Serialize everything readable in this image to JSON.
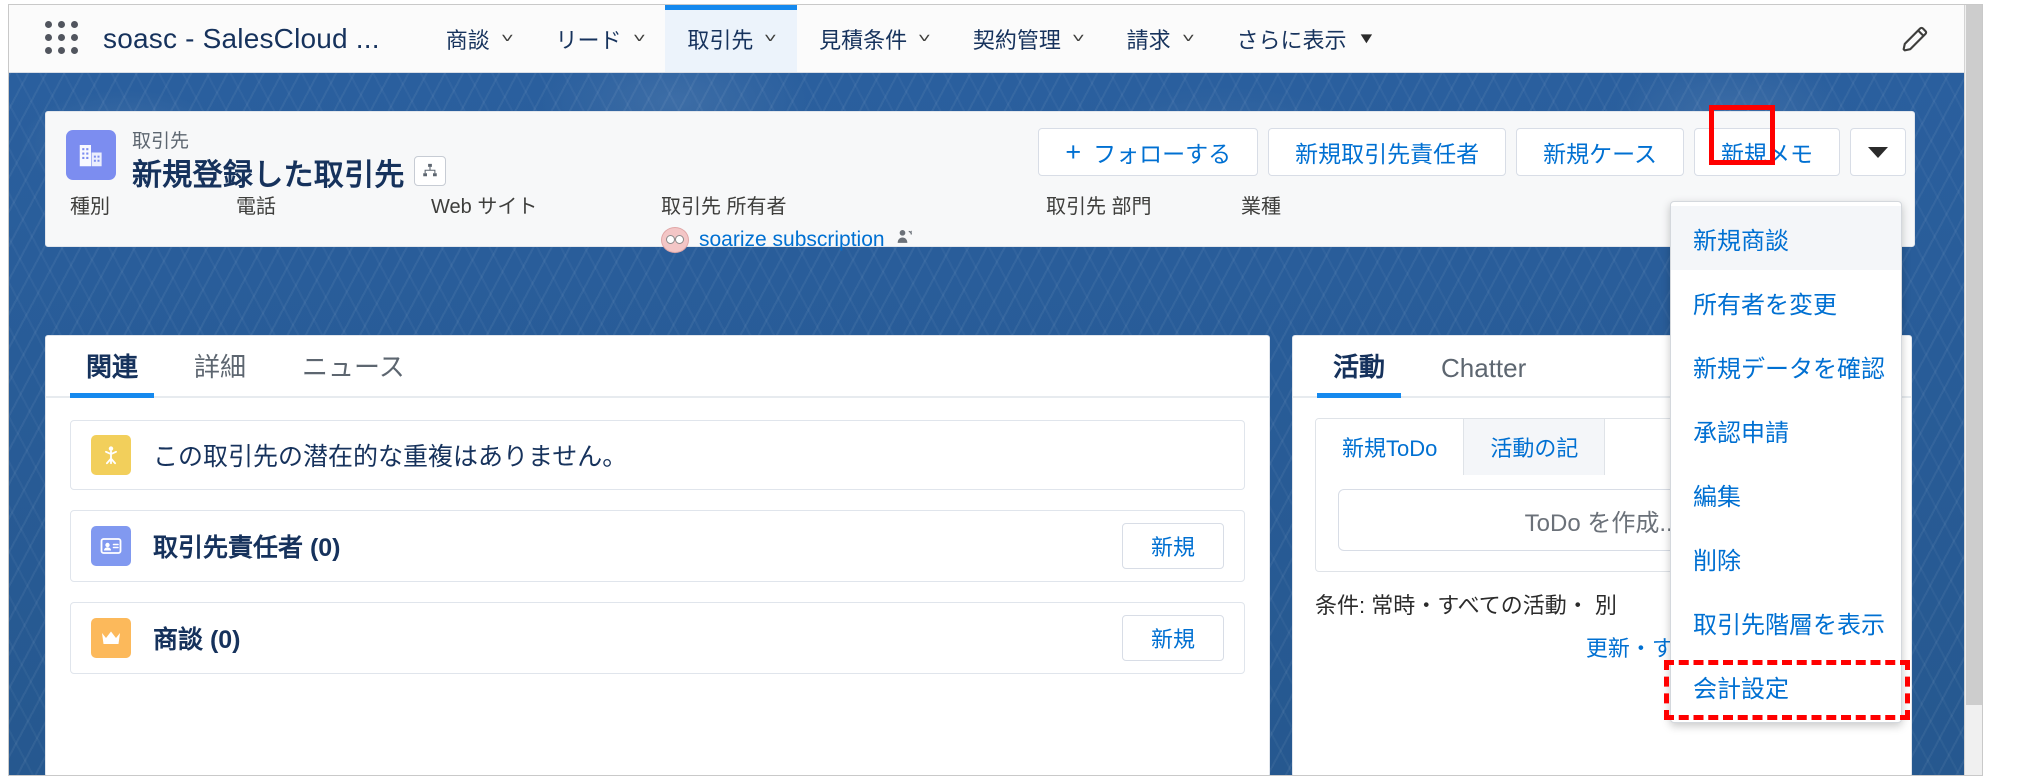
{
  "window": {
    "app_name": "soasc - SalesCloud ..."
  },
  "global_nav": {
    "app_launcher_icon": "app-launcher-grid-icon",
    "edit_icon": "pencil-icon",
    "items": [
      {
        "label": "商談",
        "icon": "chevron-down-icon",
        "active": false,
        "solid_caret": false
      },
      {
        "label": "リード",
        "icon": "chevron-down-icon",
        "active": false,
        "solid_caret": false
      },
      {
        "label": "取引先",
        "icon": "chevron-down-icon",
        "active": true,
        "solid_caret": false
      },
      {
        "label": "見積条件",
        "icon": "chevron-down-icon",
        "active": false,
        "solid_caret": false
      },
      {
        "label": "契約管理",
        "icon": "chevron-down-icon",
        "active": false,
        "solid_caret": false
      },
      {
        "label": "請求",
        "icon": "chevron-down-icon",
        "active": false,
        "solid_caret": false
      },
      {
        "label": "さらに表示",
        "icon": "caret-down-solid-icon",
        "active": false,
        "solid_caret": true
      }
    ]
  },
  "record_header": {
    "object_icon": "account-building-icon",
    "eyebrow": "取引先",
    "title": "新規登録した取引先",
    "badge_icon": "account-hierarchy-icon",
    "actions": [
      {
        "label": "フォローする",
        "icon": "plus-icon"
      },
      {
        "label": "新規取引先責任者",
        "icon": ""
      },
      {
        "label": "新規ケース",
        "icon": ""
      },
      {
        "label": "新規メモ",
        "icon": ""
      }
    ],
    "dropdown_button": {
      "name": "more-actions-dropdown",
      "icon": "caret-down-solid-icon"
    },
    "fields": [
      {
        "label": "種別",
        "value": ""
      },
      {
        "label": "電話",
        "value": ""
      },
      {
        "label": "Web サイト",
        "value": ""
      },
      {
        "label": "取引先 所有者",
        "value": "soarize subscription",
        "avatar": "user-avatar",
        "trailing_icon": "change-owner-icon"
      },
      {
        "label": "取引先 部門",
        "value": ""
      },
      {
        "label": "業種",
        "value": ""
      }
    ]
  },
  "action_menu": {
    "items": [
      {
        "label": "新規商談",
        "hover": true,
        "highlighted": false
      },
      {
        "label": "所有者を変更",
        "hover": false,
        "highlighted": false
      },
      {
        "label": "新規データを確認",
        "hover": false,
        "highlighted": false
      },
      {
        "label": "承認申請",
        "hover": false,
        "highlighted": false
      },
      {
        "label": "編集",
        "hover": false,
        "highlighted": false
      },
      {
        "label": "削除",
        "hover": false,
        "highlighted": false
      },
      {
        "label": "取引先階層を表示",
        "hover": false,
        "highlighted": false
      },
      {
        "label": "会計設定",
        "hover": false,
        "highlighted": true
      }
    ]
  },
  "left_panel": {
    "tabs": [
      {
        "label": "関連",
        "active": true
      },
      {
        "label": "詳細",
        "active": false
      },
      {
        "label": "ニュース",
        "active": false
      }
    ],
    "duplicate_banner": {
      "icon": "duplicate-check-icon",
      "text": "この取引先の潜在的な重複はありません。"
    },
    "related_lists": [
      {
        "icon": "contact-card-icon",
        "title": "取引先責任者 (0)",
        "button": "新規"
      },
      {
        "icon": "opportunity-crown-icon",
        "title": "商談 (0)",
        "button": "新規"
      }
    ]
  },
  "right_panel": {
    "tabs": [
      {
        "label": "活動",
        "active": true
      },
      {
        "label": "Chatter",
        "active": false
      }
    ],
    "composer_tabs": [
      {
        "label": "新規ToDo",
        "active": true
      },
      {
        "label": "活動の記",
        "active": false
      }
    ],
    "composer_placeholder": "ToDo を作成...",
    "filter_text": "条件: 常時・すべての活動・\n別",
    "filter_links": "更新・すべて展開・すべて表示"
  },
  "colors": {
    "brand_blue": "#0070d2",
    "nav_active_underline": "#1589ee",
    "page_background": "#2a5f9e",
    "highlight_red": "#ff0000",
    "title_navy": "#16325c"
  }
}
